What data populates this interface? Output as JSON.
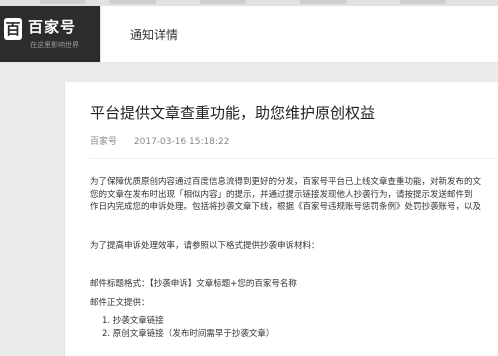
{
  "brand": {
    "logo_char": "百",
    "name": "百家号",
    "slogan": "在这里影响世界"
  },
  "header": {
    "page_title": "通知详情"
  },
  "article": {
    "title": "平台提供文章查重功能，助您维护原创权益",
    "author": "百家号",
    "timestamp": "2017-03-16 15:18:22",
    "paragraph1": [
      "为了保障优质原创内容通过百度信息流得到更好的分发，百家号平台已上线文章查重功能，对新发布的文",
      "您的文章在发布时出现「相似内容」的提示，并通过提示链接发现他人抄袭行为，请按提示发送邮件到",
      "作日内完成您的申诉处理。包括将抄袭文章下线，根据《百家号违规账号惩罚条例》处罚抄袭账号，以及"
    ],
    "paragraph2": "为了提高申诉处理效率，请参照以下格式提供抄袭申诉材料：",
    "email_subject_line": "邮件标题格式：【抄袭申诉】文章标题+您的百家号名称",
    "email_body_label": "邮件正文提供：",
    "list_items": [
      "1. 抄袭文章链接",
      "2. 原创文章链接（发布时间需早于抄袭文章）"
    ]
  }
}
